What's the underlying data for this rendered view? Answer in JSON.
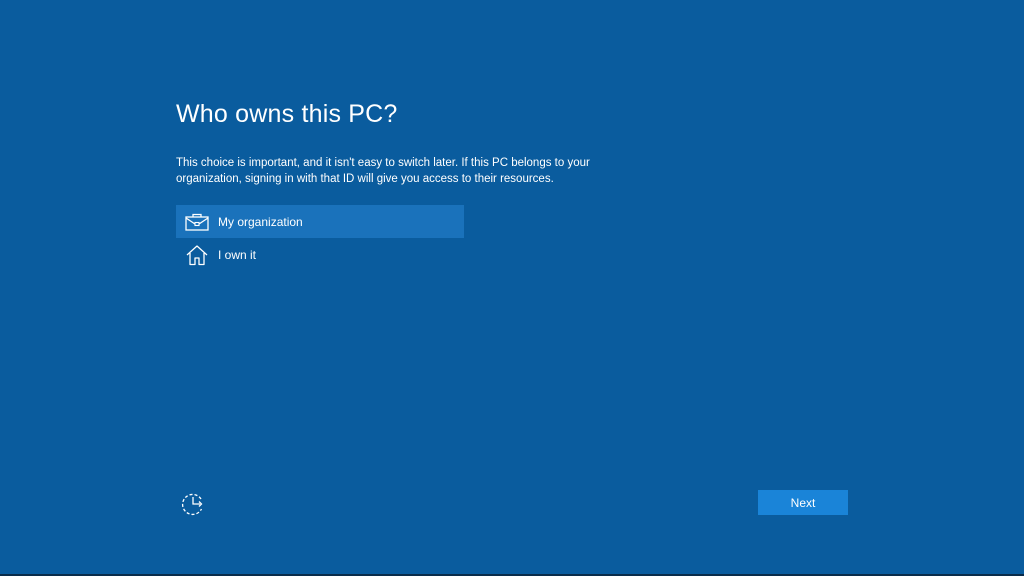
{
  "page": {
    "title": "Who owns this PC?",
    "description": "This choice is important, and it isn't easy to switch later. If this PC belongs to your organization, signing in with that ID will give you access to their resources."
  },
  "options": [
    {
      "label": "My organization",
      "icon": "briefcase-icon",
      "selected": true
    },
    {
      "label": "I own it",
      "icon": "home-icon",
      "selected": false
    }
  ],
  "footer": {
    "progress_icon": "clock-arrow-icon",
    "next_label": "Next"
  },
  "colors": {
    "background": "#0a5c9e",
    "selected_option": "#1a72bb",
    "button": "#1a84d8",
    "text": "#ffffff"
  }
}
